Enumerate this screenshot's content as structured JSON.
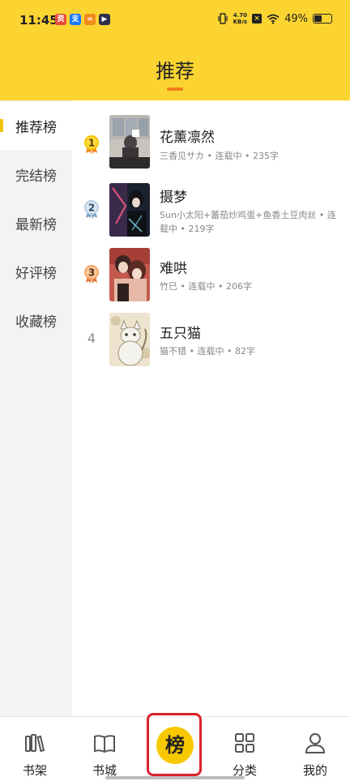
{
  "status_bar": {
    "time": "11:45",
    "app_icons": [
      {
        "name": "red-app-icon",
        "color": "#e84a3a",
        "glyph": "资"
      },
      {
        "name": "alipay-icon",
        "color": "#1677ff",
        "glyph": "支"
      },
      {
        "name": "orange-app-icon",
        "color": "#f08a1c",
        "glyph": "∞"
      },
      {
        "name": "dark-app-icon",
        "color": "#2b2f4a",
        "glyph": "▶"
      }
    ],
    "net_speed_value": "4.70",
    "net_speed_unit": "KB/s",
    "battery": "49%",
    "battery_level": 0.49
  },
  "header": {
    "title": "推荐",
    "background": "#fbd432",
    "underline_color": "#f07f1a"
  },
  "sidebar": {
    "items": [
      {
        "label": "推荐榜",
        "active": true
      },
      {
        "label": "完结榜",
        "active": false
      },
      {
        "label": "最新榜",
        "active": false
      },
      {
        "label": "好评榜",
        "active": false
      },
      {
        "label": "收藏榜",
        "active": false
      }
    ]
  },
  "books": [
    {
      "rank": "1",
      "title": "花薰凛然",
      "meta": "三香见サカ • 连载中 • 235字",
      "medal": "gold"
    },
    {
      "rank": "2",
      "title": "摄梦",
      "meta": "Sun小太阳+蕃茄炒鸡蛋+鱼香土豆肉丝 • 连载中 • 219字",
      "medal": "silver"
    },
    {
      "rank": "3",
      "title": "难哄",
      "meta": "竹已 • 连载中 • 206字",
      "medal": "bronze"
    },
    {
      "rank": "4",
      "title": "五只猫",
      "meta": "猫不错 • 连载中 • 82字",
      "medal": "none"
    }
  ],
  "bottom_nav": {
    "items": [
      {
        "label": "书架",
        "icon": "bookshelf-icon"
      },
      {
        "label": "书城",
        "icon": "open-book-icon"
      },
      {
        "label": "榜",
        "icon": "ranking-icon",
        "active": true
      },
      {
        "label": "分类",
        "icon": "category-grid-icon"
      },
      {
        "label": "我的",
        "icon": "profile-icon"
      }
    ],
    "active_color": "#f8c800",
    "highlight_color": "#d9232e"
  }
}
